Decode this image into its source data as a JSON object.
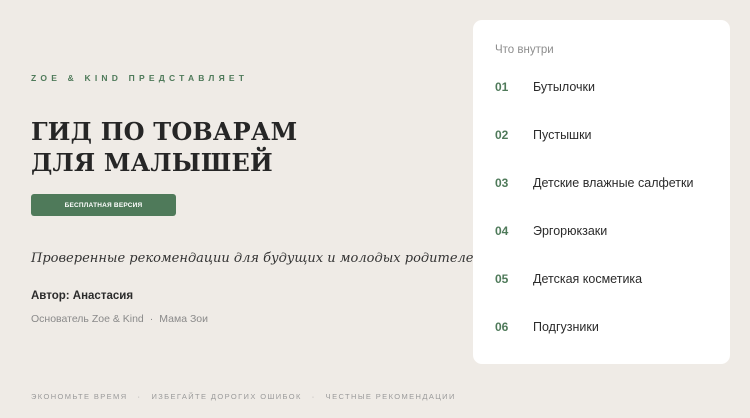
{
  "presents": "ZOE & KIND ПРЕДСТАВЛЯЕТ",
  "title_lines": [
    "ГИД ПО ТОВАРАМ",
    "ДЛЯ МАЛЫШЕЙ"
  ],
  "badge": "БЕСПЛАТНАЯ ВЕРСИЯ",
  "subtitle": "Проверенные рекомендации для будущих и молодых родителей",
  "author": "Автор: Анастасия",
  "role": {
    "founder": "Основатель Zoe & Kind",
    "separator": "·",
    "mom": "Мама Зои"
  },
  "footer": {
    "items": [
      "ЭКОНОМЬТЕ ВРЕМЯ",
      "ИЗБЕГАЙТЕ ДОРОГИХ ОШИБОК",
      "ЧЕСТНЫЕ РЕКОМЕНДАЦИИ"
    ],
    "separator": "·"
  },
  "contents": {
    "heading": "Что внутри",
    "items": [
      {
        "num": "01",
        "label": "Бутылочки"
      },
      {
        "num": "02",
        "label": "Пустышки"
      },
      {
        "num": "03",
        "label": "Детские влажные салфетки"
      },
      {
        "num": "04",
        "label": "Эргорюкзаки"
      },
      {
        "num": "05",
        "label": "Детская косметика"
      },
      {
        "num": "06",
        "label": "Подгузники"
      }
    ]
  },
  "colors": {
    "background": "#efebe6",
    "accent": "#4f7a5a",
    "card": "#ffffff"
  }
}
